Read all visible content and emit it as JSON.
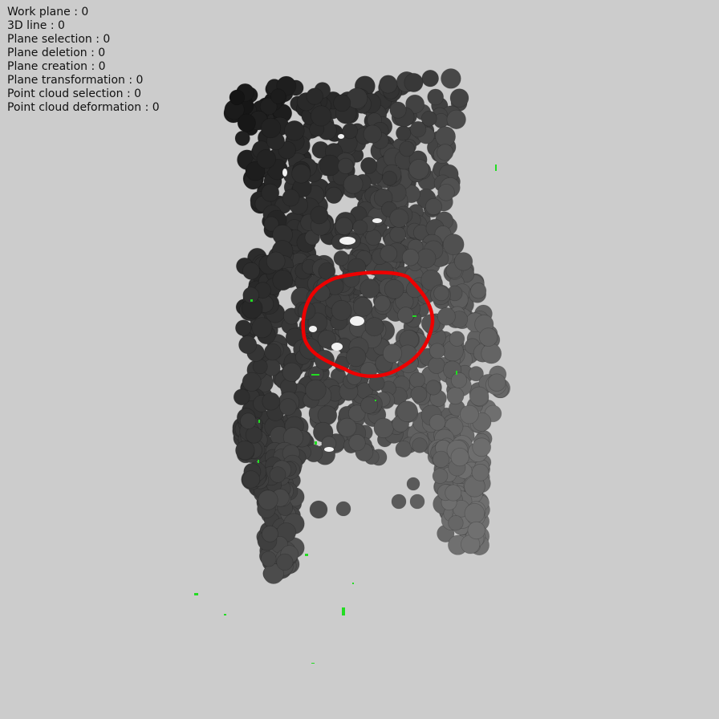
{
  "counters": [
    {
      "label": "Work plane",
      "value": "0"
    },
    {
      "label": "3D line",
      "value": "0"
    },
    {
      "label": "Plane selection",
      "value": "0"
    },
    {
      "label": "Plane deletion",
      "value": "0"
    },
    {
      "label": "Plane creation",
      "value": "0"
    },
    {
      "label": "Plane transformation",
      "value": "0"
    },
    {
      "label": "Point cloud selection",
      "value": "0"
    },
    {
      "label": "Point cloud deformation",
      "value": "0"
    }
  ],
  "colors": {
    "background": "#cccccc",
    "selection_stroke": "#ee0000",
    "outlier_points": "#22dd22",
    "point_dark": "#151515",
    "point_light": "#6a6a6a"
  },
  "scene": {
    "object": "chair-point-cloud",
    "selection_tool": "freehand-lasso"
  }
}
